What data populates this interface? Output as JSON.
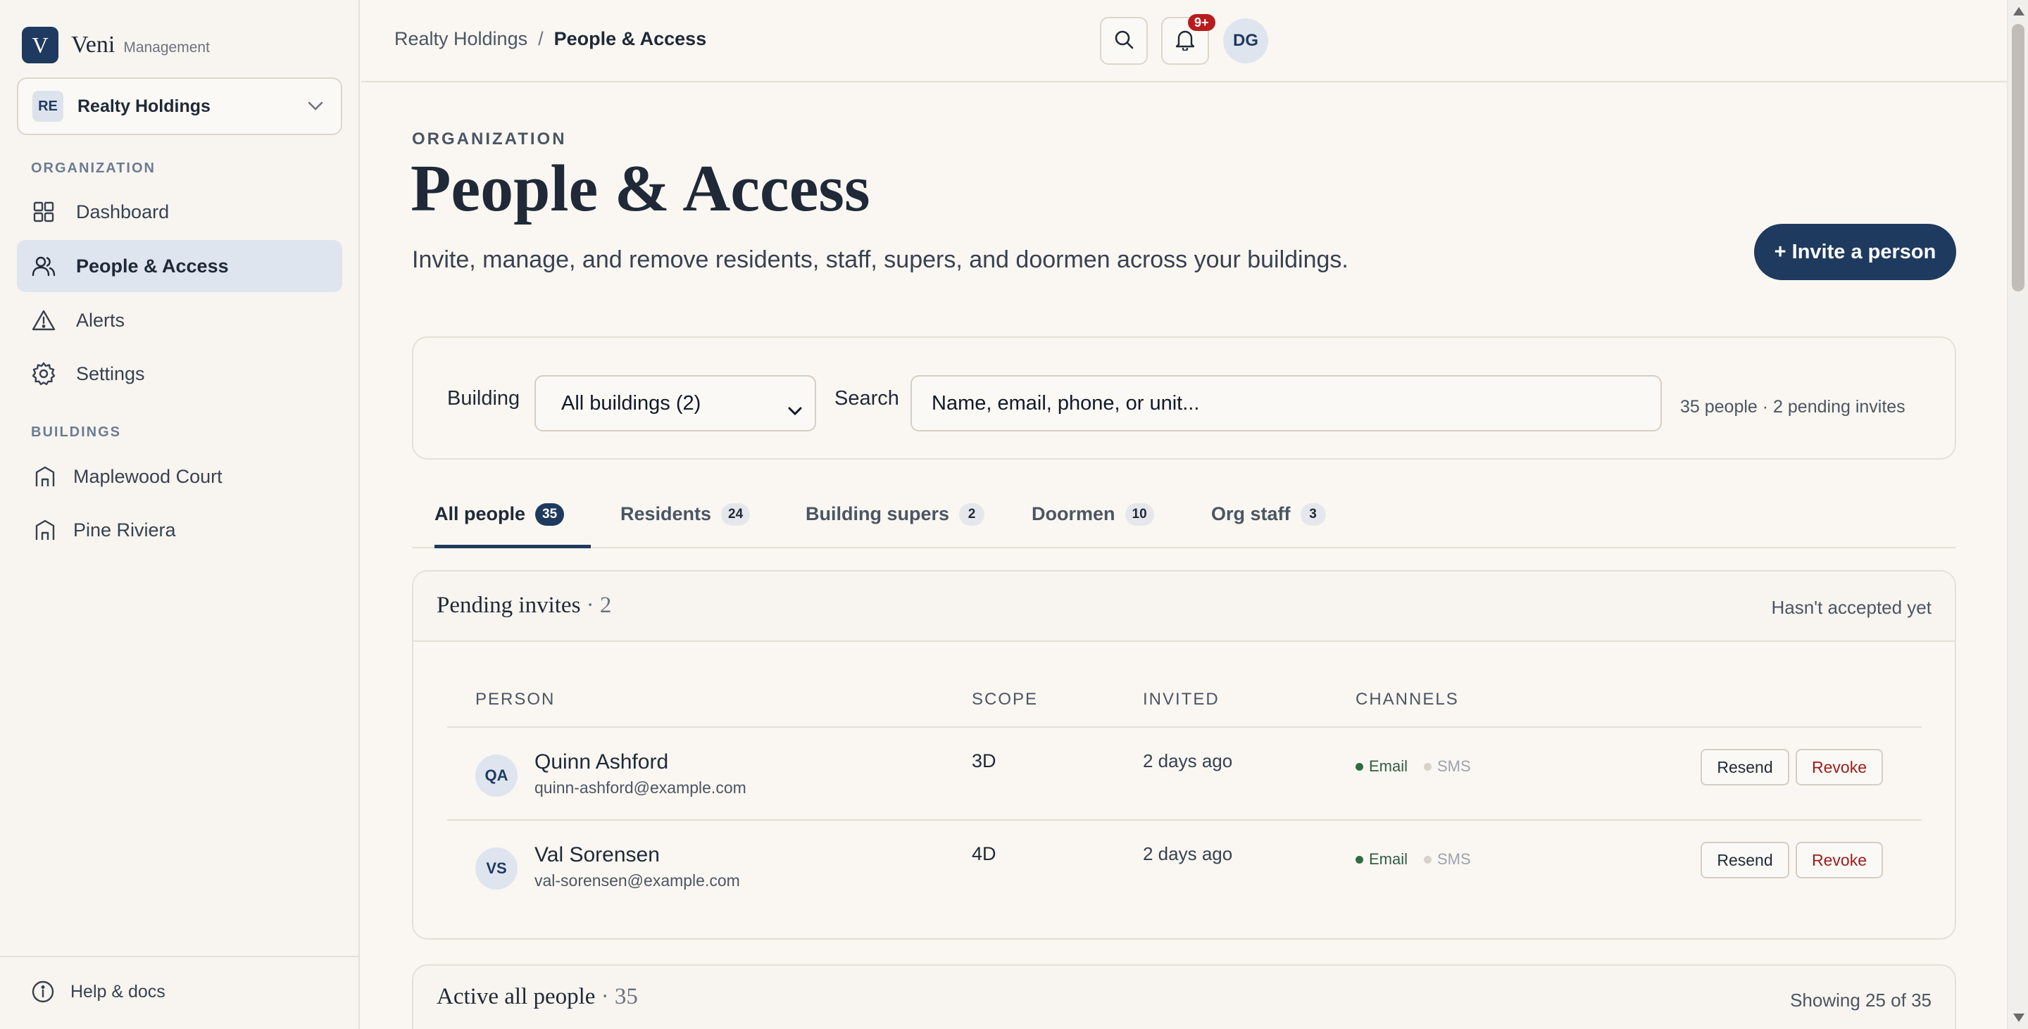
{
  "brand": {
    "mark": "V",
    "name": "Veni",
    "sub": "Management"
  },
  "org": {
    "badge": "RE",
    "name": "Realty Holdings"
  },
  "sidebar": {
    "org_section": "ORGANIZATION",
    "org_items": [
      {
        "label": "Dashboard",
        "icon": "grid-icon"
      },
      {
        "label": "People & Access",
        "icon": "users-icon",
        "active": true
      },
      {
        "label": "Alerts",
        "icon": "warning-icon"
      },
      {
        "label": "Settings",
        "icon": "gear-icon"
      }
    ],
    "buildings_section": "BUILDINGS",
    "buildings": [
      {
        "label": "Maplewood Court",
        "icon": "building-icon"
      },
      {
        "label": "Pine Riviera",
        "icon": "building-icon"
      }
    ],
    "help": "Help & docs"
  },
  "topbar": {
    "crumb_root": "Realty Holdings",
    "crumb_sep": "/",
    "crumb_current": "People & Access",
    "notif_count": "9+",
    "user_initials": "DG"
  },
  "page": {
    "eyebrow": "ORGANIZATION",
    "title": "People & Access",
    "subtitle": "Invite, manage, and remove residents, staff, supers, and doormen across your buildings.",
    "invite_label": "+ Invite a person"
  },
  "filters": {
    "building_label": "Building",
    "building_value": "All buildings (2)",
    "search_label": "Search",
    "search_placeholder": "Name, email, phone, or unit...",
    "count_text": "35 people · 2 pending invites"
  },
  "tabs": [
    {
      "label": "All people",
      "count": "35",
      "active": true
    },
    {
      "label": "Residents",
      "count": "24"
    },
    {
      "label": "Building supers",
      "count": "2"
    },
    {
      "label": "Doormen",
      "count": "10"
    },
    {
      "label": "Org staff",
      "count": "3"
    }
  ],
  "pending": {
    "title": "Pending invites",
    "count": "· 2",
    "note": "Hasn't accepted yet",
    "columns": [
      "PERSON",
      "SCOPE",
      "INVITED",
      "CHANNELS"
    ],
    "rows": [
      {
        "initials": "QA",
        "name": "Quinn Ashford",
        "email": "quinn-ashford@example.com",
        "scope": "3D",
        "invited": "2 days ago",
        "ch1": "Email",
        "ch2": "SMS",
        "resend": "Resend",
        "revoke": "Revoke"
      },
      {
        "initials": "VS",
        "name": "Val Sorensen",
        "email": "val-sorensen@example.com",
        "scope": "4D",
        "invited": "2 days ago",
        "ch1": "Email",
        "ch2": "SMS",
        "resend": "Resend",
        "revoke": "Revoke"
      }
    ]
  },
  "active": {
    "title": "Active all people",
    "count": "· 35",
    "note": "Showing 25 of 35"
  },
  "colors": {
    "brand": "#1f3a5f",
    "danger": "#b91c1c",
    "background": "#faf7f2"
  }
}
